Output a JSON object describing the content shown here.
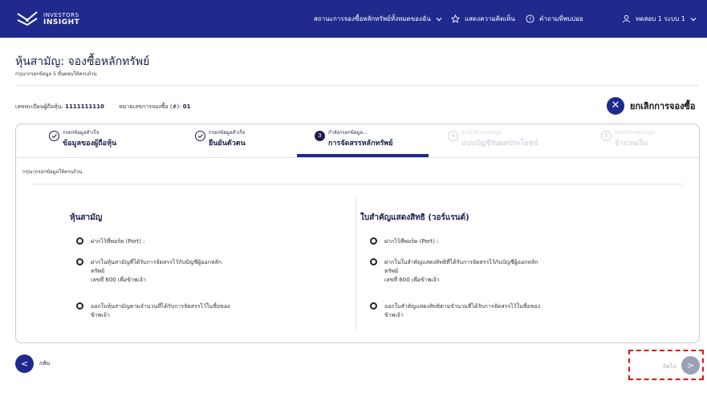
{
  "header": {
    "brand_line1": "INVESTORS",
    "brand_line2": "INSIGHT",
    "nav_subscription_status": "สถานะการจองซื้อหลักทรัพย์ทั้งหมดของฉัน",
    "nav_feedback": "แสดงความคิดเห็น",
    "nav_faq": "คำถามที่พบบ่อย",
    "user_name": "ทดสอบ 1 ระบบ 1",
    "icons": [
      "logo-icon",
      "chevron-down-icon",
      "star-icon",
      "help-circle-icon",
      "user-icon",
      "chevron-down-icon"
    ]
  },
  "page": {
    "title": "หุ้นสามัญ: จองซื้อหลักทรัพย์",
    "subtitle": "กรุณากรอกข้อมูล 5 ขั้นตอนให้ครบถ้วน"
  },
  "meta": {
    "shareholder_label": "เลขทะเบียนผู้ถือหุ้น:",
    "shareholder_value": "1111111110",
    "order_label": "หมายเลขการจองซื้อ (#):",
    "order_value": "01"
  },
  "cancel_label": "ยกเลิกการจองซื้อ",
  "steps": [
    {
      "status": "กรอกข้อมูลสำเร็จ",
      "title": "ข้อมูลของผู้ถือหุ้น",
      "state": "done"
    },
    {
      "status": "กรอกข้อมูลสำเร็จ",
      "title": "ยืนยันตัวตน",
      "state": "done"
    },
    {
      "status": "กำลังกรอกข้อมูล...",
      "title": "การจัดสรรหลักทรัพย์",
      "state": "current",
      "number": "3"
    },
    {
      "status": "ยังไม่ได้กรอกข้อมูล",
      "title": "แบบบัญชีรับผลประโยชน์",
      "state": "future",
      "number": "4"
    },
    {
      "status": "ยังไม่ได้กรอกข้อมูล",
      "title": "จำนวนเงิน",
      "state": "future",
      "number": "5"
    }
  ],
  "fill_note": "กรุณากรอกข้อมูลให้ครบถ้วน",
  "sections": {
    "left": {
      "title": "หุ้นสามัญ",
      "options": [
        "ฝากไว้ที่พอร์ต (Port) :",
        "ฝากในหุ้นสามัญที่ได้รับการจัดสรรไว้กับบัญชีผู้ออกหลัก",
        "ทรัพย์",
        "เลขที่ 600 เพื่อข้าพเจ้า",
        "ออกใบหุ้นสามัญตามจำนวนที่ได้รับการจัดสรรไว้ในชื่อของ",
        "ข้าพเจ้า"
      ]
    },
    "right": {
      "title": "ใบสำคัญแสดงสิทธิ (วอร์แรนต์)",
      "options": [
        "ฝากไว้ที่พอร์ต (Port) :",
        "ฝากในใบสำคัญแสดงสิทธิที่ได้รับการจัดสรรไว้กับบัญชีผู้ออกหลัก",
        "ทรัพย์",
        "เลขที่ 600 เพื่อข้าพเจ้า",
        "ออกใบสำคัญแสดงสิทธิตามจำนวนที่ได้รับการจัดสรรไว้ในชื่อของ",
        "ข้าพเจ้า"
      ]
    }
  },
  "footer": {
    "back_label": "กลับ",
    "next_label": "ถัดไป"
  },
  "colors": {
    "primary": "#1f2a8c",
    "highlight_border": "#dd1111",
    "disabled": "#9aa1b5"
  }
}
